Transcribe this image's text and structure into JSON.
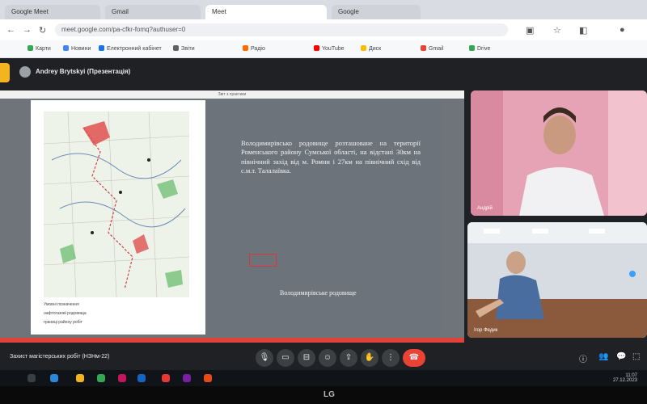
{
  "browser": {
    "tabs": [
      "Google Meet",
      "Gmail",
      "Meet",
      "Google"
    ],
    "url": "meet.google.com/pa-cfkr-fomq?authuser=0",
    "bookmarks": [
      "Карти",
      "Новини",
      "Електронний кабінет",
      "Звіти",
      "Радіо",
      "YouTube",
      "Диск",
      "Gmail",
      "Drive"
    ]
  },
  "meet": {
    "presenter": "Andrey Brytskyi (Презентація)",
    "presentation_title": "Звіт з практики",
    "slide": {
      "paragraph": "Володимирівсько родовище розташоване на території Роменського району Сумської області, на відстані 30км на північний захід від м. Ромни і 27км на північний схід від с.м.т. Талалаївка.",
      "caption": "Володимирівське родовище",
      "legend": [
        "Умовні позначення",
        "нафтогазові родовища",
        "границі району робіт"
      ]
    },
    "participants": [
      {
        "name": "Андрій"
      },
      {
        "name": "Ігор Федик"
      }
    ],
    "meeting_label": "Захист магістерських робіт (НЗНм-22)",
    "controls": [
      "mic",
      "camera",
      "captions",
      "emoji",
      "present",
      "hand",
      "more",
      "end-call"
    ]
  },
  "taskbar": {
    "time": "11:07",
    "date": "27.12.2023"
  },
  "monitor": {
    "brand": "LG"
  },
  "colors": {
    "meet_bg": "#202124",
    "end_call": "#ea4335",
    "slide_bg": "#6c737b"
  }
}
